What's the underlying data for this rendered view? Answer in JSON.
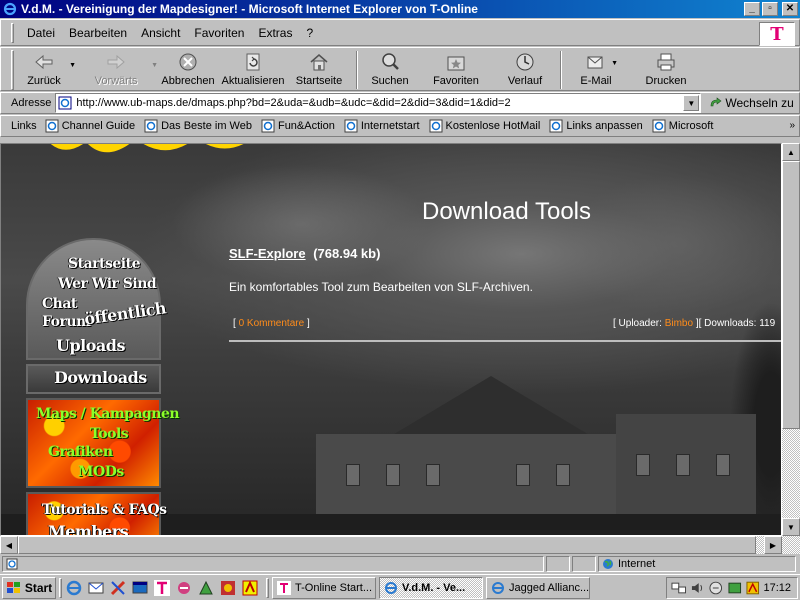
{
  "window": {
    "title": "V.d.M. - Vereinigung der Mapdesigner! - Microsoft Internet Explorer von T-Online",
    "minimize": "_",
    "maximize": "▫",
    "close": "✕"
  },
  "menu": [
    "Datei",
    "Bearbeiten",
    "Ansicht",
    "Favoriten",
    "Extras",
    "?"
  ],
  "brand_logo": "T",
  "toolbar": {
    "back": "Zurück",
    "forward": "Vorwärts",
    "stop": "Abbrechen",
    "refresh": "Aktualisieren",
    "home": "Startseite",
    "search": "Suchen",
    "favorites": "Favoriten",
    "history": "Verlauf",
    "mail": "E-Mail",
    "print": "Drucken"
  },
  "address": {
    "label": "Adresse",
    "url": "http://www.ub-maps.de/dmaps.php?bd=2&uda=&udb=&udc=&did=2&did=3&did=1&did=2",
    "go": "Wechseln zu"
  },
  "links": {
    "label": "Links",
    "items": [
      "Channel Guide",
      "Das Beste im Web",
      "Fun&Action",
      "Internetstart",
      "Kostenlose HotMail",
      "Links anpassen",
      "Microsoft"
    ],
    "more": "»"
  },
  "page": {
    "heading": "Download Tools",
    "download": {
      "name": "SLF-Explore",
      "size": "(768.94 kb)",
      "description": "Ein komfortables Tool zum Bearbeiten von SLF-Archiven.",
      "comments_open": "[",
      "comments_link": "0 Kommentare",
      "comments_close": "]",
      "uploader_label": "[ Uploader:",
      "uploader_name": "Bimbo",
      "downloads_label": "][ Downloads: 119"
    },
    "nav": {
      "startseite": "Startseite",
      "wer_wir_sind": "Wer Wir Sind",
      "chat": "Chat",
      "forum": "Forum",
      "oeffentlich": "öffentlich",
      "uploads": "Uploads",
      "downloads": "Downloads",
      "maps": "Maps / Kampagnen",
      "tools": "Tools",
      "grafiken": "Grafiken",
      "mods": "MODs",
      "tutorials": "Tutorials & FAQs",
      "members": "Members"
    }
  },
  "statusbar": {
    "zone": "Internet"
  },
  "taskbar": {
    "start": "Start",
    "tasks": [
      "T-Online Start...",
      "V.d.M. - Ve...",
      "Jagged Allianc..."
    ],
    "clock": "17:12"
  },
  "colors": {
    "titlebar": "#000080",
    "link_orange": "#ff8c1a",
    "nav_green": "#8cff2a",
    "brand_magenta": "#e20074"
  }
}
